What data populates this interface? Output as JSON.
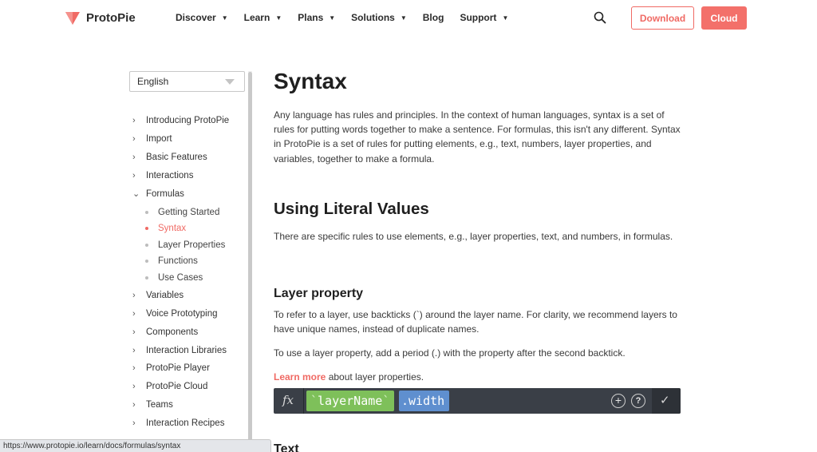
{
  "brand": {
    "name": "ProtoPie",
    "accent": "#f06a64"
  },
  "nav": {
    "items": [
      {
        "label": "Discover",
        "has_caret": true
      },
      {
        "label": "Learn",
        "has_caret": true
      },
      {
        "label": "Plans",
        "has_caret": true
      },
      {
        "label": "Solutions",
        "has_caret": true
      },
      {
        "label": "Blog",
        "has_caret": false
      },
      {
        "label": "Support",
        "has_caret": true
      }
    ],
    "download_label": "Download",
    "cloud_label": "Cloud",
    "search_icon": "search-icon"
  },
  "sidebar": {
    "language": "English",
    "items": [
      {
        "label": "Introducing ProtoPie",
        "expanded": false
      },
      {
        "label": "Import",
        "expanded": false
      },
      {
        "label": "Basic Features",
        "expanded": false
      },
      {
        "label": "Interactions",
        "expanded": false
      },
      {
        "label": "Formulas",
        "expanded": true
      },
      {
        "label": "Variables",
        "expanded": false
      },
      {
        "label": "Voice Prototyping",
        "expanded": false
      },
      {
        "label": "Components",
        "expanded": false
      },
      {
        "label": "Interaction Libraries",
        "expanded": false
      },
      {
        "label": "ProtoPie Player",
        "expanded": false
      },
      {
        "label": "ProtoPie Cloud",
        "expanded": false
      },
      {
        "label": "Teams",
        "expanded": false
      },
      {
        "label": "Interaction Recipes",
        "expanded": false
      }
    ],
    "formula_children": [
      {
        "label": "Getting Started",
        "active": false
      },
      {
        "label": "Syntax",
        "active": true
      },
      {
        "label": "Layer Properties",
        "active": false
      },
      {
        "label": "Functions",
        "active": false
      },
      {
        "label": "Use Cases",
        "active": false
      }
    ]
  },
  "content": {
    "title": "Syntax",
    "intro": "Any language has rules and principles. In the context of human languages, syntax is a set of rules for putting words together to make a sentence. For formulas, this isn't any different. Syntax in ProtoPie is a set of rules for putting elements, e.g., text, numbers, layer properties, and variables, together to make a formula.",
    "section_title": "Using Literal Values",
    "section_intro": "There are specific rules to use elements, e.g., layer properties, text, and numbers, in formulas.",
    "subsection_title": "Layer property",
    "layer_para_1": "To refer to a layer, use backticks (`) around the layer name. For clarity, we recommend layers to have unique names, instead of duplicate names.",
    "layer_para_2": "To use a layer property, add a period (.) with the property after the second backtick.",
    "learn_more_link": "Learn more",
    "learn_more_rest": " about layer properties.",
    "formula": {
      "fx_label": "fx",
      "layer_token": "layerName",
      "prop_token": ".width"
    },
    "next_section_title": "Text"
  },
  "status_bar": {
    "url": "https://www.protopie.io/learn/docs/formulas/syntax"
  }
}
